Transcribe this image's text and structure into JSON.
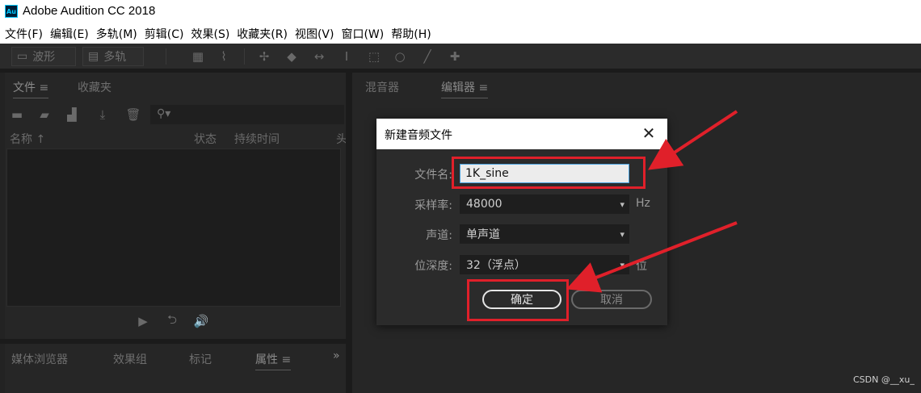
{
  "window": {
    "app_logo": "Au",
    "title": "Adobe Audition CC 2018"
  },
  "menu": [
    "文件(F)",
    "编辑(E)",
    "多轨(M)",
    "剪辑(C)",
    "效果(S)",
    "收藏夹(R)",
    "视图(V)",
    "窗口(W)",
    "帮助(H)"
  ],
  "toolbar": {
    "waveform_label": "波形",
    "multitrack_label": "多轨",
    "icons": [
      "spectral-display-icon",
      "pitch-display-icon",
      "move-tool-icon",
      "razor-tool-icon",
      "slip-tool-icon",
      "time-selection-icon",
      "marquee-icon",
      "lasso-icon",
      "brush-icon",
      "spot-healing-icon"
    ]
  },
  "files_panel": {
    "tab_files": "文件",
    "tab_favorites": "收藏夹",
    "col_name": "名称",
    "col_status": "状态",
    "col_duration": "持续时间",
    "col_extra": "头"
  },
  "bottom_panel": {
    "tab_media": "媒体浏览器",
    "tab_effects": "效果组",
    "tab_markers": "标记",
    "tab_properties": "属性",
    "more": "»"
  },
  "editor_panel": {
    "tab_mixer": "混音器",
    "tab_editor": "编辑器"
  },
  "dialog": {
    "title": "新建音频文件",
    "filename_label": "文件名:",
    "filename_value": "1K_sine",
    "samplerate_label": "采样率:",
    "samplerate_value": "48000",
    "samplerate_unit": "Hz",
    "channels_label": "声道:",
    "channels_value": "单声道",
    "bitdepth_label": "位深度:",
    "bitdepth_value": "32（浮点）",
    "bitdepth_unit": "位",
    "ok_label": "确定",
    "cancel_label": "取消"
  },
  "annotations": {
    "highlight_color": "#e0202a"
  },
  "watermark": "CSDN @__xu_"
}
